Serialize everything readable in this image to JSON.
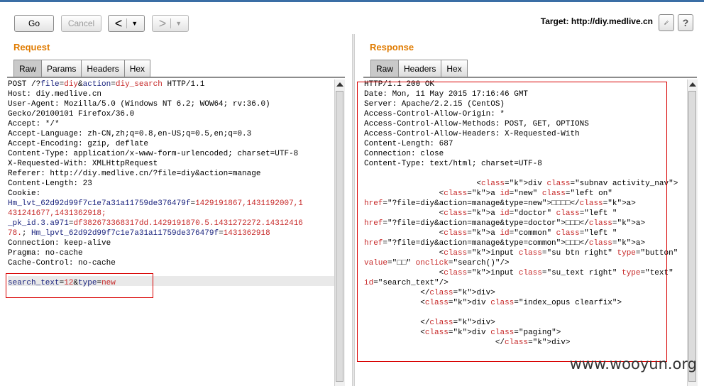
{
  "toolbar": {
    "go_label": "Go",
    "cancel_label": "Cancel",
    "back_label": "<",
    "forward_label": ">",
    "dropdown_caret": "▼",
    "target_text": "Target: http://diy.medlive.cn",
    "help_label": "?"
  },
  "request": {
    "title": "Request",
    "tabs": [
      "Raw",
      "Params",
      "Headers",
      "Hex"
    ],
    "lines": [
      "POST /?file=diy&action=diy_search HTTP/1.1",
      "Host: diy.medlive.cn",
      "User-Agent: Mozilla/5.0 (Windows NT 6.2; WOW64; rv:36.0)",
      "Gecko/20100101 Firefox/36.0",
      "Accept: */*",
      "Accept-Language: zh-CN,zh;q=0.8,en-US;q=0.5,en;q=0.3",
      "Accept-Encoding: gzip, deflate",
      "Content-Type: application/x-www-form-urlencoded; charset=UTF-8",
      "X-Requested-With: XMLHttpRequest",
      "Referer: http://diy.medlive.cn/?file=diy&action=manage",
      "Content-Length: 23",
      "Cookie:",
      "Hm_lvt_62d92d99f7c1e7a31a11759de376479f=1429191867,1431192007,1",
      "431241677,1431362918;",
      "_pk_id.3.a971=df382673368317dd.1429191870.5.1431272272.14312416",
      "78.; Hm_lpvt_62d92d99f7c1e7a31a11759de376479f=1431362918",
      "Connection: keep-alive",
      "Pragma: no-cache",
      "Cache-Control: no-cache",
      "",
      "search_text=12&type=new"
    ]
  },
  "response": {
    "title": "Response",
    "tabs": [
      "Raw",
      "Headers",
      "Hex"
    ],
    "lines": [
      "HTTP/1.1 200 OK",
      "Date: Mon, 11 May 2015 17:16:46 GMT",
      "Server: Apache/2.2.15 (CentOS)",
      "Access-Control-Allow-Origin: *",
      "Access-Control-Allow-Methods: POST, GET, OPTIONS",
      "Access-Control-Allow-Headers: X-Requested-With",
      "Content-Length: 687",
      "Connection: close",
      "Content-Type: text/html; charset=UTF-8",
      "",
      "                        <div class=\"subnav activity_nav\">",
      "                <a id=\"new\" class=\"left on\"",
      "href=\"?file=diy&action=manage&type=new\">□□□□</a>",
      "                <a id=\"doctor\" class=\"left \"",
      "href=\"?file=diy&action=manage&type=doctor\">□□□</a>",
      "                <a id=\"common\" class=\"left \"",
      "href=\"?file=diy&action=manage&type=common\">□□□</a>",
      "                <input class=\"su btn right\" type=\"button\"",
      "value=\"□□\" onclick=\"search()\"/>",
      "                <input class=\"su_text right\" type=\"text\"",
      "id=\"search_text\"/>",
      "            </div>",
      "            <div class=\"index_opus clearfix\">",
      "",
      "            </div>",
      "            <div class=\"paging\">",
      "                            </div>"
    ]
  },
  "watermark": "www.wooyun.org"
}
